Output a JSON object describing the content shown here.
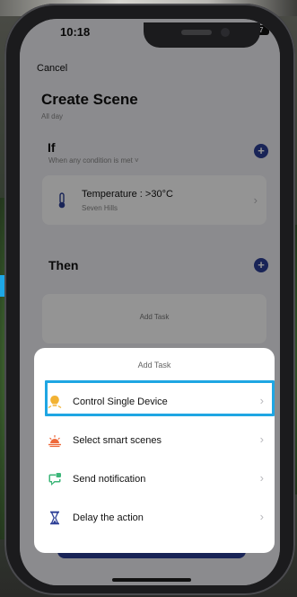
{
  "status": {
    "time": "10:18",
    "battery": "67"
  },
  "nav": {
    "cancel": "Cancel"
  },
  "page": {
    "title": "Create Scene",
    "subtitle": "All day"
  },
  "if_section": {
    "title": "If",
    "subtitle": "When any condition is met ˅",
    "condition": {
      "title": "Temperature : >30°C",
      "subtitle": "Seven Hills",
      "icon": "thermometer-icon"
    }
  },
  "then_section": {
    "title": "Then",
    "add_task": "Add Task"
  },
  "sheet": {
    "title": "Add Task",
    "items": [
      {
        "label": "Control Single Device",
        "icon": "bulb-icon",
        "highlighted": true
      },
      {
        "label": "Select smart scenes",
        "icon": "sunrise-icon"
      },
      {
        "label": "Send notification",
        "icon": "chat-icon"
      },
      {
        "label": "Delay the action",
        "icon": "hourglass-icon"
      }
    ]
  },
  "colors": {
    "accent": "#2c3f96",
    "highlight": "#1fa6e3",
    "sheet_bg": "#ffffff"
  }
}
